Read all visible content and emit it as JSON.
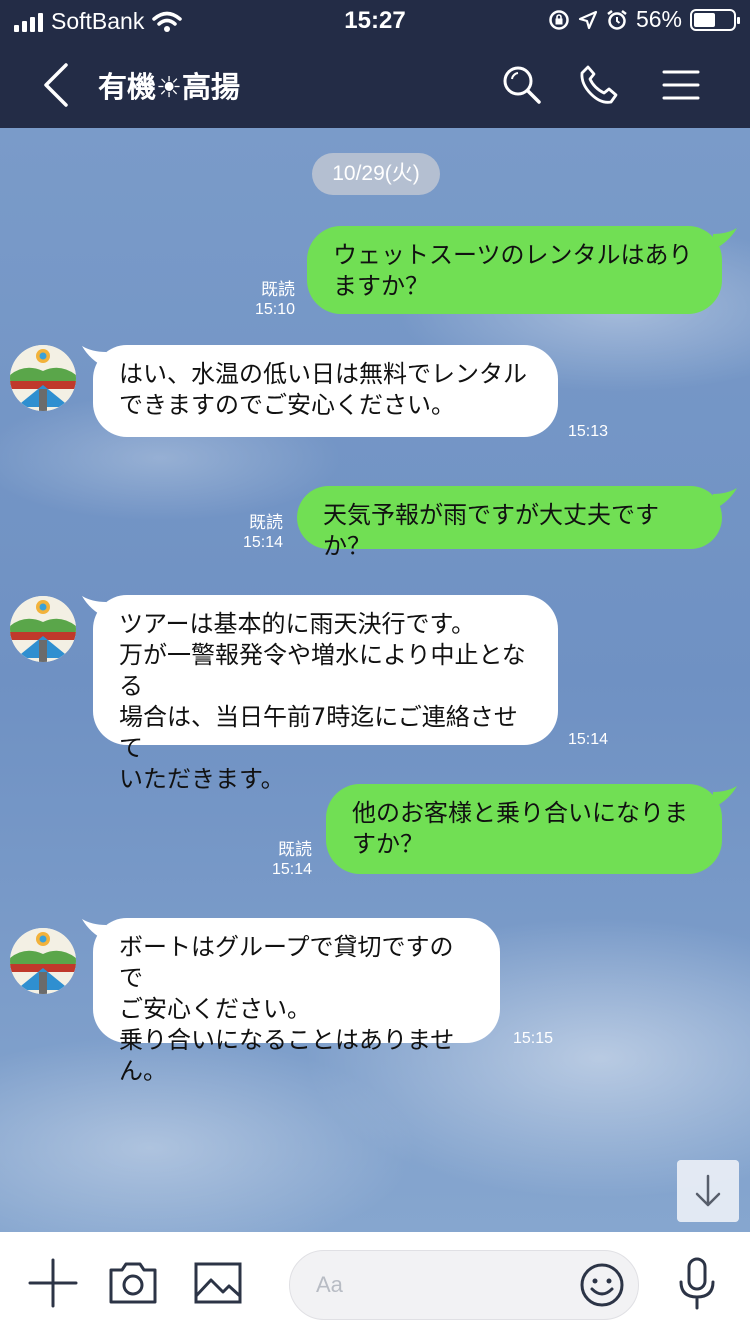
{
  "status_bar": {
    "carrier": "SoftBank",
    "time": "15:27",
    "battery": "56%",
    "battery_level": 0.56
  },
  "header": {
    "title": "有機☀高揚"
  },
  "chat": {
    "date_label": "10/29(火)",
    "messages": [
      {
        "direction": "out",
        "text": "ウェットスーツのレンタルはあり\nますか？",
        "read_label": "既読",
        "time": "15:10"
      },
      {
        "direction": "in",
        "text": "はい、水温の低い日は無料でレンタル\nできますのでご安心ください。",
        "time": "15:13"
      },
      {
        "direction": "out",
        "text": "天気予報が雨ですが大丈夫ですか？",
        "read_label": "既読",
        "time": "15:14"
      },
      {
        "direction": "in",
        "text": "ツアーは基本的に雨天決行です。\n万が一警報発令や増水により中止となる\n場合は、当日午前7時迄にご連絡させて\nいただきます。",
        "time": "15:14"
      },
      {
        "direction": "out",
        "text": "他のお客様と乗り合いになりま\nすか？",
        "read_label": "既読",
        "time": "15:14"
      },
      {
        "direction": "in",
        "text": "ボートはグループで貸切ですので\nご安心ください。\n乗り合いになることはありません。",
        "time": "15:15"
      }
    ]
  },
  "input": {
    "placeholder": "Aa"
  },
  "colors": {
    "header_bg": "#232c46",
    "outgoing_bubble": "#71df54",
    "incoming_bubble": "#ffffff"
  },
  "icons": [
    "back-icon",
    "search-icon",
    "phone-icon",
    "menu-icon",
    "plus-icon",
    "camera-icon",
    "image-icon",
    "emoji-icon",
    "mic-icon",
    "arrow-down-icon"
  ]
}
